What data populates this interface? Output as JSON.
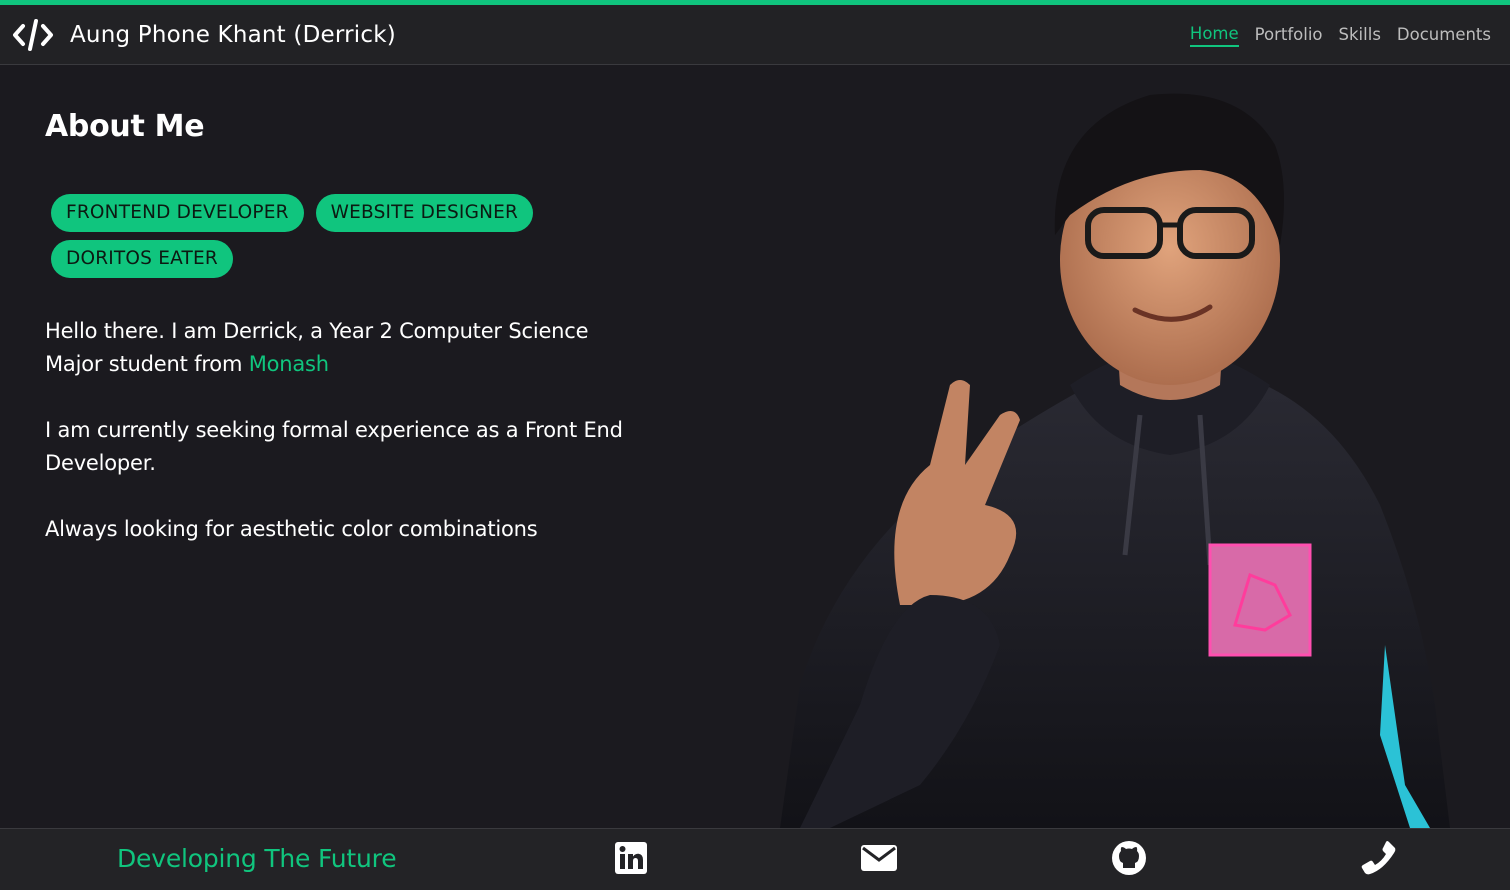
{
  "header": {
    "logo_icon": "code-icon",
    "brand_name": "Aung Phone Khant (Derrick)",
    "accent_color": "#10c57e",
    "nav": [
      {
        "label": "Home",
        "active": true
      },
      {
        "label": "Portfolio",
        "active": false
      },
      {
        "label": "Skills",
        "active": false
      },
      {
        "label": "Documents",
        "active": false
      }
    ]
  },
  "about": {
    "title": "About Me",
    "tags": [
      "FRONTEND DEVELOPER",
      "WEBSITE DESIGNER",
      "DORITOS EATER"
    ],
    "bio_line1_prefix": "Hello there. I am Derrick, a Year 2 Computer Science Major student from ",
    "bio_line1_highlight": "Monash",
    "bio_line2": "I am currently seeking formal experience as a Front End Developer.",
    "bio_line3": "Always looking for aesthetic color combinations"
  },
  "footer": {
    "tagline": "Developing The Future",
    "icons": [
      "linkedin-icon",
      "email-icon",
      "github-icon",
      "phone-icon"
    ]
  }
}
